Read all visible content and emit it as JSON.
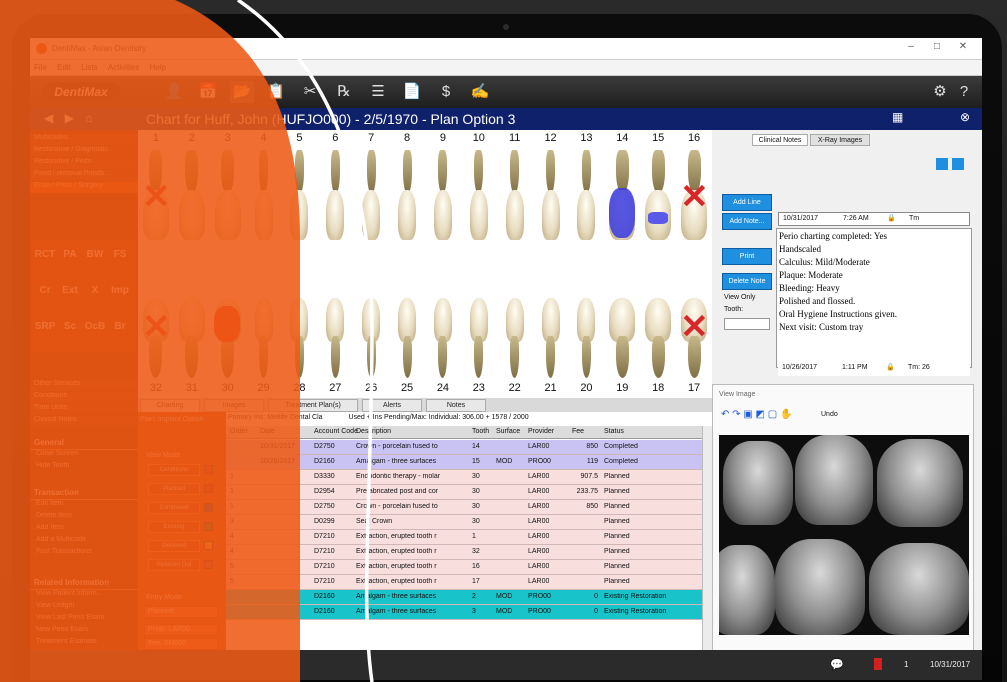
{
  "window": {
    "title": "DentiMax - Asian Dentistry"
  },
  "menu": [
    "File",
    "Edit",
    "Lists",
    "Activities",
    "Help"
  ],
  "logo": "DentiMax",
  "toolbar": {
    "icons": [
      "patient-icon",
      "calendar-icon",
      "folder-icon",
      "clipboard-icon",
      "tools-icon",
      "rx-icon",
      "checklist-icon",
      "document-icon",
      "dollar-icon",
      "signature-icon"
    ],
    "glyphs": [
      "👤",
      "📅",
      "📂",
      "📋",
      "✂",
      "℞",
      "☰",
      "📄",
      "$",
      "✍"
    ],
    "right_glyphs": [
      "⚙",
      "?"
    ]
  },
  "patient": {
    "title": "Chart for Huff, John (HUFJO000) - 2/5/1970 - Plan Option 3",
    "nav": "◀ ▶ ⌂"
  },
  "sidebar": {
    "top_items": [
      "Multicodes",
      "Restorative / Diagnostic",
      "Restorative / Pedo",
      "Fixed / removal Prosth...",
      "Endo / Perio / Surgery"
    ],
    "grid_labels": [
      "RCT",
      "PA",
      "BW",
      "FS",
      "Cr",
      "Ext",
      "X",
      "Imp",
      "SRP",
      "Sc",
      "OcB",
      "Br"
    ],
    "other_items": [
      "Other Services",
      "Conditions",
      "Time Units",
      "Clinical Notes"
    ],
    "general_head": "General",
    "general": [
      "Close Screen",
      "Hide Tooth"
    ],
    "transaction_head": "Transaction",
    "transaction": [
      "Edit Item",
      "Delete Item",
      "Add Item",
      "Add a Multicode",
      "Post Transactions"
    ],
    "related_head": "Related Information",
    "related": [
      "View Patient Inform...",
      "View Ledger",
      "View Last Perio Exam",
      "New Perio Exam",
      "Treatment Estimate",
      "New Pretreatment C...",
      "Bookmark this window"
    ]
  },
  "teeth": {
    "upper": [
      "1",
      "2",
      "3",
      "4",
      "5",
      "6",
      "7",
      "8",
      "9",
      "10",
      "11",
      "12",
      "13",
      "14",
      "15",
      "16"
    ],
    "lower": [
      "32",
      "31",
      "30",
      "29",
      "28",
      "27",
      "26",
      "25",
      "24",
      "23",
      "22",
      "21",
      "20",
      "19",
      "18",
      "17"
    ]
  },
  "chart_tabs": [
    "Charting",
    "Images",
    "Treatment Plan(s)",
    "Alerts",
    "Notes"
  ],
  "panel": {
    "plan": "Plan: Implant Option",
    "view_mode": "View Mode",
    "buttons": [
      "Conditions",
      "Planned",
      "Completed",
      "Existing",
      "Declined",
      "Referred Out"
    ],
    "swatch_colors": [
      "#d01818",
      "#c81010",
      "#1e2a8a",
      "#1f6a22",
      "#f2a41a",
      "#b62a2a"
    ],
    "entry_mode": "Entry Mode",
    "entry_value": "Planned",
    "provider": "Prvdr: LAR00",
    "fee": "Fee: SM000"
  },
  "treatment": {
    "info_left": "Primary Ins: Metlife Dental Cla",
    "info_right": "Used + Ins Pending/Max: Individual: 306.00 + 1578 / 2000",
    "columns": [
      "Order",
      "Date",
      "Account Code",
      "Description",
      "Tooth",
      "Surface",
      "Provider",
      "Fee",
      "Status"
    ],
    "rows": [
      {
        "order": "",
        "date": "10/31/2017",
        "code": "D2750",
        "desc": "Crown - porcelain fused to",
        "tooth": "14",
        "surface": "",
        "provider": "LAR00",
        "fee": "850",
        "status": "Completed",
        "bg": "#c9c3f3"
      },
      {
        "order": "",
        "date": "10/26/2017",
        "code": "D2160",
        "desc": "Amalgam - three surfaces",
        "tooth": "15",
        "surface": "MOD",
        "provider": "PRO00",
        "fee": "119",
        "status": "Completed",
        "bg": "#c9c3f3"
      },
      {
        "order": "1",
        "date": "",
        "code": "D3330",
        "desc": "Endodontic therapy - molar",
        "tooth": "30",
        "surface": "",
        "provider": "LAR00",
        "fee": "907.5",
        "status": "Planned",
        "bg": "#f9dede"
      },
      {
        "order": "1",
        "date": "",
        "code": "D2954",
        "desc": "Prefabricated post and cor",
        "tooth": "30",
        "surface": "",
        "provider": "LAR00",
        "fee": "233.75",
        "status": "Planned",
        "bg": "#f9dede"
      },
      {
        "order": "1",
        "date": "",
        "code": "D2750",
        "desc": "Crown - porcelain fused to",
        "tooth": "30",
        "surface": "",
        "provider": "LAR00",
        "fee": "850",
        "status": "Planned",
        "bg": "#f9dede"
      },
      {
        "order": "3",
        "date": "",
        "code": "D0299",
        "desc": "Seal Crown",
        "tooth": "30",
        "surface": "",
        "provider": "LAR00",
        "fee": "",
        "status": "Planned",
        "bg": "#f9dede"
      },
      {
        "order": "4",
        "date": "",
        "code": "D7210",
        "desc": "Extraction, erupted tooth r",
        "tooth": "1",
        "surface": "",
        "provider": "LAR00",
        "fee": "",
        "status": "Planned",
        "bg": "#f9dede"
      },
      {
        "order": "4",
        "date": "",
        "code": "D7210",
        "desc": "Extraction, erupted tooth r",
        "tooth": "32",
        "surface": "",
        "provider": "LAR00",
        "fee": "",
        "status": "Planned",
        "bg": "#f9dede"
      },
      {
        "order": "5",
        "date": "",
        "code": "D7210",
        "desc": "Extraction, erupted tooth r",
        "tooth": "16",
        "surface": "",
        "provider": "LAR00",
        "fee": "",
        "status": "Planned",
        "bg": "#f9dede"
      },
      {
        "order": "5",
        "date": "",
        "code": "D7210",
        "desc": "Extraction, erupted tooth r",
        "tooth": "17",
        "surface": "",
        "provider": "LAR00",
        "fee": "",
        "status": "Planned",
        "bg": "#f9dede"
      },
      {
        "order": "",
        "date": "",
        "code": "D2160",
        "desc": "Amalgam - three surfaces",
        "tooth": "2",
        "surface": "MOD",
        "provider": "PRO00",
        "fee": "0",
        "status": "Existing Restoration",
        "bg": "#18c3c9"
      },
      {
        "order": "",
        "date": "",
        "code": "D2160",
        "desc": "Amalgam - three surfaces",
        "tooth": "3",
        "surface": "MOD",
        "provider": "PRO00",
        "fee": "0",
        "status": "Existing Restoration",
        "bg": "#18c3c9"
      }
    ]
  },
  "right": {
    "tabs": [
      "Clinical Notes",
      "X-Ray Images"
    ],
    "buttons": [
      "Add Line",
      "Add Note...",
      "Print",
      "Delete Note"
    ],
    "view_only": "View Only",
    "tooth_label": "Tooth:",
    "note1": {
      "date": "10/31/2017",
      "time": "7:26 AM",
      "tm": "Tm"
    },
    "note_lines": [
      "Perio charting completed: Yes",
      "Handscaled",
      "Calculus: Mild/Moderate",
      "Plaque: Moderate",
      "Bleeding: Heavy",
      "Polished and flossed.",
      "Oral Hygiene Instructions given.",
      "Next visit: Custom tray"
    ],
    "note2": {
      "date": "10/26/2017",
      "time": "1:11 PM",
      "tm": "Tm: 26"
    },
    "view_image": "View Image",
    "undo": "Undo"
  },
  "status": {
    "count": "1",
    "date": "10/31/2017"
  },
  "colors": {
    "brand_orange": "#e8561c",
    "header_blue": "#10216b",
    "accent_blue": "#1f8fe0"
  }
}
